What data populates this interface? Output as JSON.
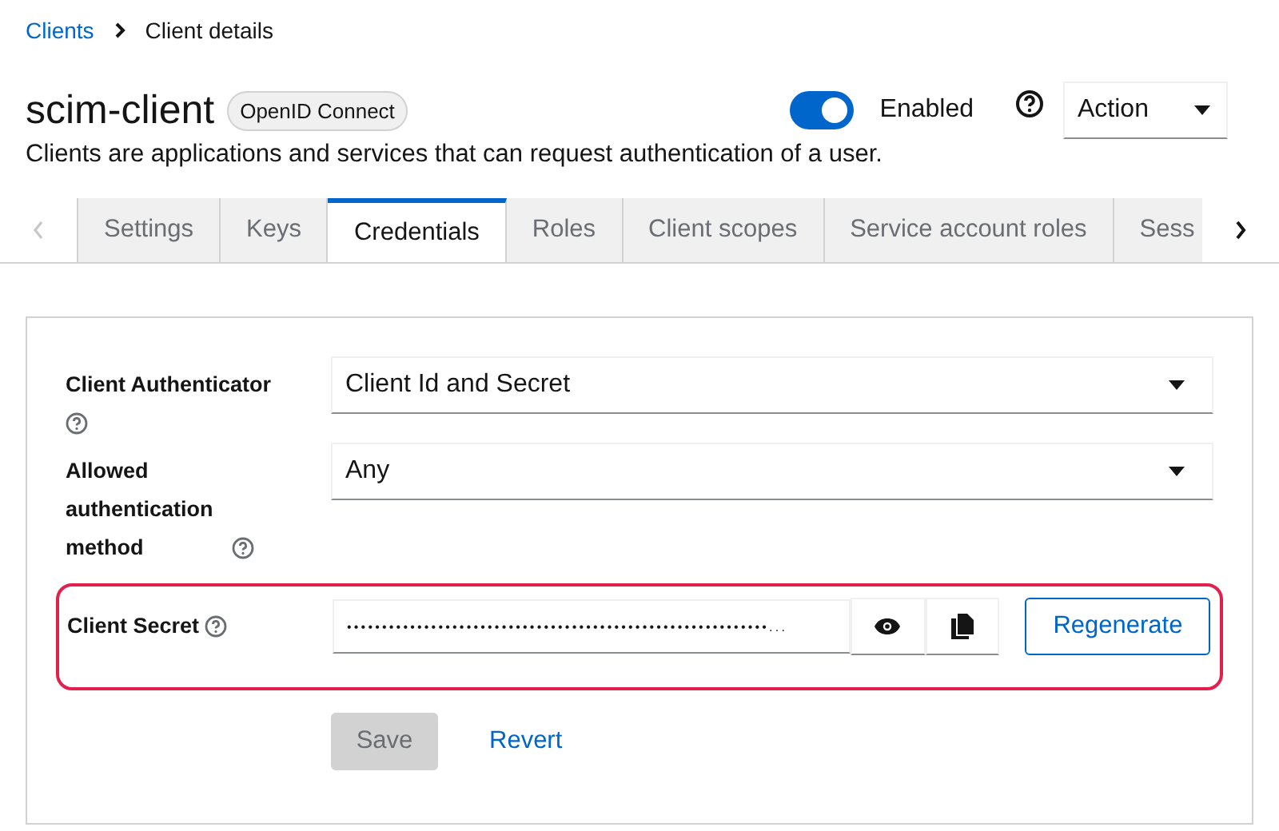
{
  "breadcrumbs": [
    {
      "label": "Clients",
      "link": true
    },
    {
      "label": "Client details",
      "link": false
    }
  ],
  "header": {
    "title": "scim-client",
    "badge": "OpenID Connect",
    "enabled": {
      "on": true,
      "label": "Enabled"
    },
    "action": "Action",
    "description": "Clients are applications and services that can request authentication of a user."
  },
  "tabs": [
    {
      "label": "Settings",
      "selected": false
    },
    {
      "label": "Keys",
      "selected": false
    },
    {
      "label": "Credentials",
      "selected": true
    },
    {
      "label": "Roles",
      "selected": false
    },
    {
      "label": "Client scopes",
      "selected": false
    },
    {
      "label": "Service account roles",
      "selected": false
    },
    {
      "label": "Sess",
      "selected": false
    }
  ],
  "form": {
    "client_authenticator": {
      "label": "Client Authenticator",
      "value": "Client Id and Secret"
    },
    "allowed_method": {
      "label": "Allowed authentication method",
      "value": "Any"
    },
    "client_secret": {
      "label": "Client Secret",
      "value": "••••••••••••••••••••••••••••••••••••••••••••••••••••••••••••...",
      "highlighted": true,
      "regenerate": "Regenerate"
    },
    "save": {
      "label": "Save",
      "disabled": true
    },
    "revert": "Revert"
  }
}
